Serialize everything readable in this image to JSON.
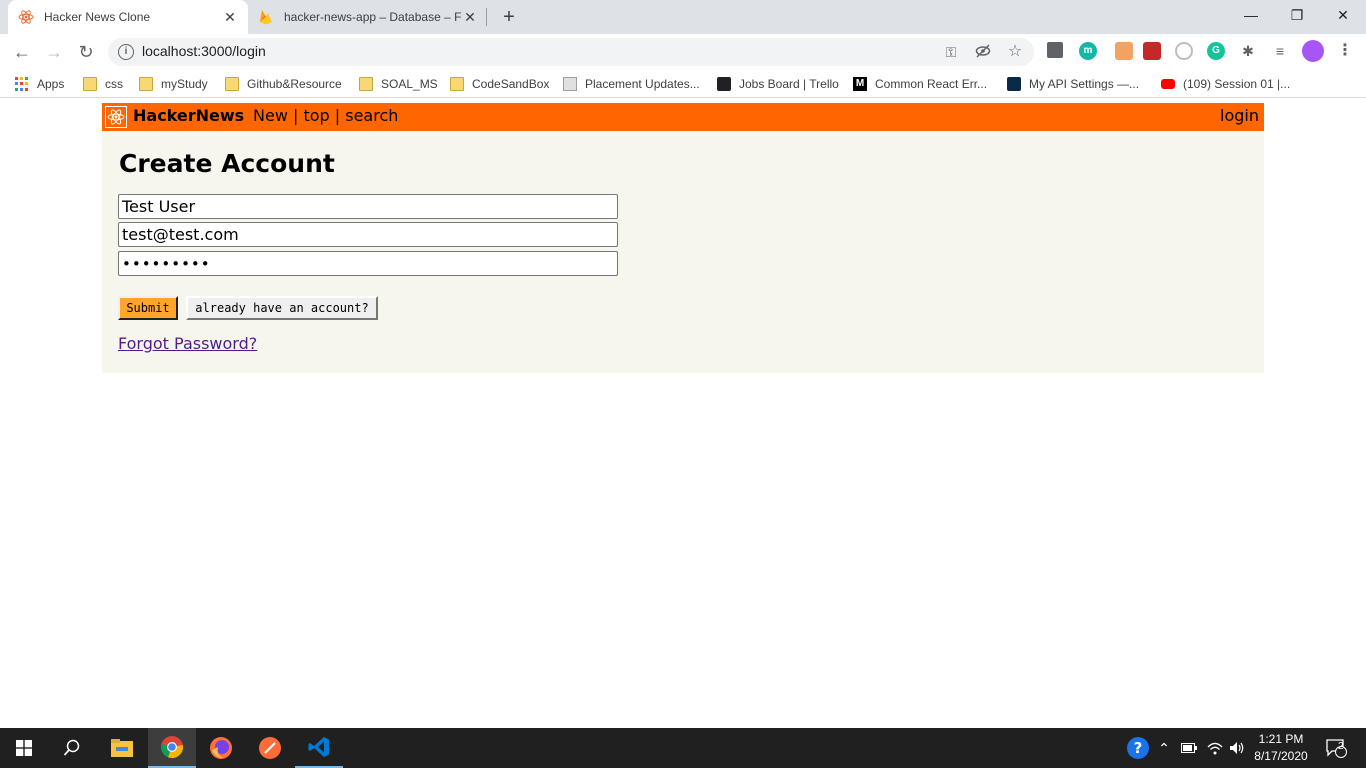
{
  "browser": {
    "tabs": [
      {
        "title": "Hacker News Clone",
        "active": true
      },
      {
        "title": "hacker-news-app – Database – Fi",
        "active": false
      }
    ],
    "close_glyph": "✕",
    "new_tab_glyph": "+",
    "window_controls": {
      "minimize": "—",
      "restore": "❐",
      "close": "✕"
    },
    "nav": {
      "back": "←",
      "forward": "→",
      "reload": "↻"
    },
    "url": "localhost:3000/login",
    "bookmarks": [
      {
        "label": "Apps",
        "icon": "apps-grid-icon"
      },
      {
        "label": "css",
        "icon": "folder-icon"
      },
      {
        "label": "myStudy",
        "icon": "folder-icon"
      },
      {
        "label": "Github&Resource",
        "icon": "folder-icon"
      },
      {
        "label": "SOAL_MS",
        "icon": "folder-icon"
      },
      {
        "label": "CodeSandBox",
        "icon": "folder-icon"
      },
      {
        "label": "Placement Updates...",
        "icon": "book-icon"
      },
      {
        "label": "Jobs Board | Trello",
        "icon": "trello-icon"
      },
      {
        "label": "Common React Err...",
        "icon": "medium-icon"
      },
      {
        "label": "My API Settings —...",
        "icon": "api-icon"
      },
      {
        "label": "(109) Session 01 |...",
        "icon": "youtube-icon"
      }
    ]
  },
  "hn": {
    "brand": "HackerNews",
    "nav": {
      "new": "New",
      "sep1": " | ",
      "top": "top",
      "sep2": " | ",
      "search": "search"
    },
    "login": "login",
    "colors": {
      "header": "#ff6600",
      "background": "#f6f6ef",
      "submit": "#ffa52c"
    }
  },
  "form": {
    "title": "Create Account",
    "name_value": "Test User",
    "email_value": "test@test.com",
    "password_mask": "•••••••••",
    "submit_label": "Submit",
    "switch_label": "already have an account?",
    "forgot_label": "Forgot Password?"
  },
  "taskbar": {
    "time": "1:21 PM",
    "date": "8/17/2020",
    "notification_count": "2"
  }
}
